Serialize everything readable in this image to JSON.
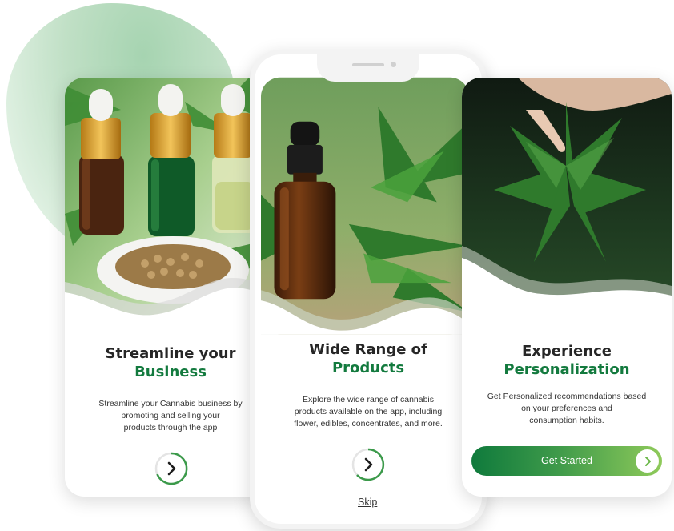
{
  "screens": [
    {
      "title_line1": "Streamline your",
      "title_line2": "Business",
      "description_lines": [
        "Streamline your Cannabis business  by",
        "promoting and selling your",
        "products through the app"
      ]
    },
    {
      "title_line1": "Wide Range of",
      "title_line2": "Products",
      "description_lines": [
        "Explore the wide range of cannabis",
        "products available on the app, including",
        "flower, edibles, concentrates, and more."
      ],
      "skip_label": "Skip"
    },
    {
      "title_line1": "Experience",
      "title_line2": "Personalization",
      "description_lines": [
        "Get Personalized recommendations based",
        "on your preferences and",
        "consumption habits."
      ],
      "cta_label": "Get Started"
    }
  ],
  "icons": {
    "next": "chevron-right-icon",
    "cta_arrow": "chevron-right-icon"
  },
  "colors": {
    "brand_green": "#137a3e",
    "accent_light_green": "#8fca5a",
    "blob_green": "#b9dcbf"
  }
}
